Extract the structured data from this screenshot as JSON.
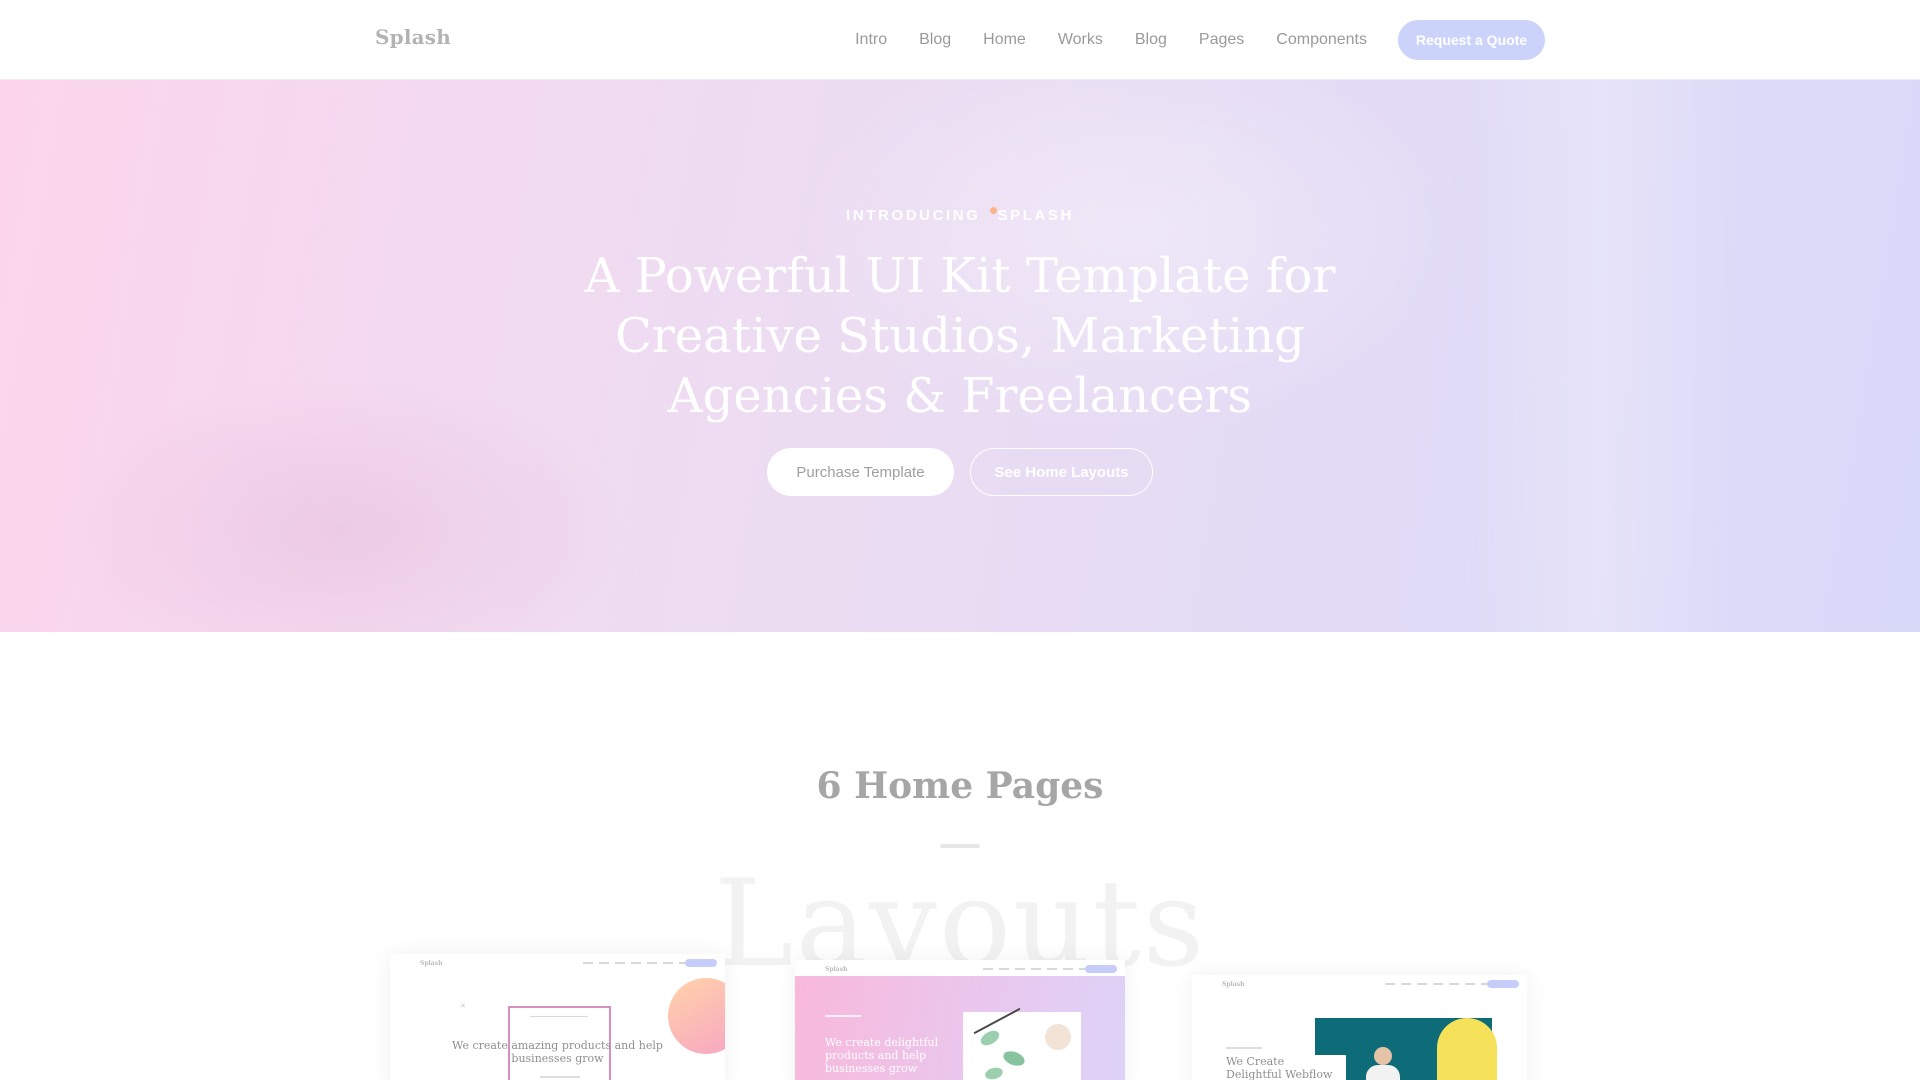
{
  "nav": {
    "brand": "Splash",
    "links": [
      "Intro",
      "Blog",
      "Home",
      "Works",
      "Blog",
      "Pages",
      "Components"
    ],
    "cta": "Request a Quote"
  },
  "hero": {
    "eyebrow_left": "INTRODUCING",
    "eyebrow_right": "SPLASH",
    "title": "A Powerful UI Kit Template for Creative Studios, Marketing Agencies & Freelancers",
    "primary_button": "Purchase Template",
    "secondary_button": "See Home Layouts"
  },
  "section": {
    "title": "6 Home Pages",
    "ghost_word": "Layouts"
  },
  "previews": [
    {
      "brand": "Splash",
      "title": "We create amazing products and help businesses grow"
    },
    {
      "brand": "Splash",
      "title": "We create delightful products and help businesses grow"
    },
    {
      "brand": "Splash",
      "title": "We Create Delightful Webflow Templates"
    }
  ],
  "colors": {
    "accent_pill": "#cbd3fb",
    "hero_start": "#fcd5ec",
    "hero_end": "#d8d8f9",
    "eyebrow_dot": "#ffb38a"
  }
}
